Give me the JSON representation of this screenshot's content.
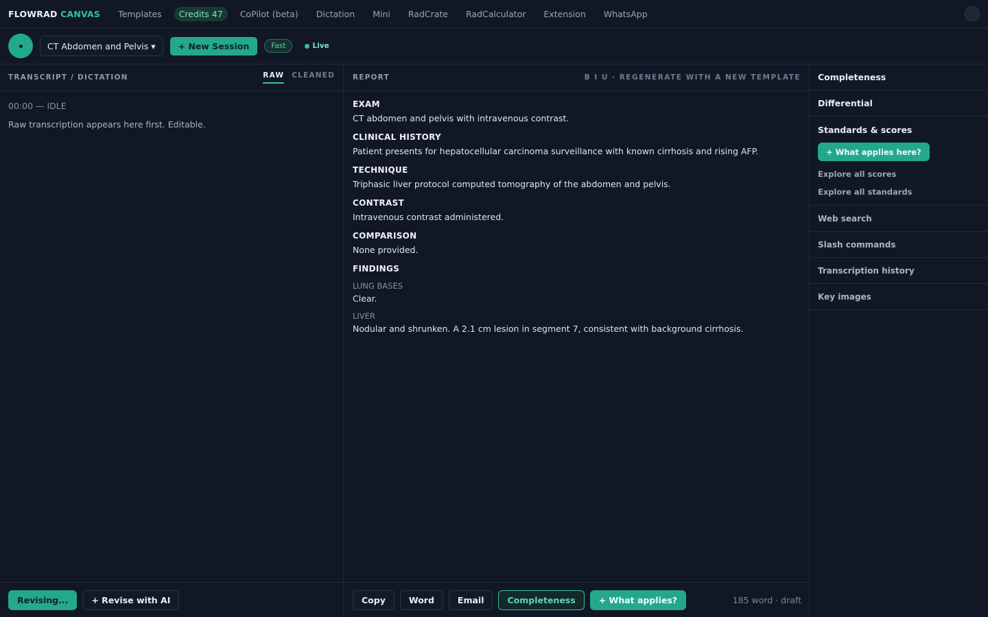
{
  "nav": {
    "brand_main": "FLOWRAD",
    "brand_accent": "CANVAS",
    "templates": "Templates",
    "credits": "Credits 47",
    "copilot": "CoPilot (beta)",
    "dictation": "Dictation",
    "mini": "Mini",
    "radcrate": "RadCrate",
    "radcalculator": "RadCalculator",
    "extension": "Extension",
    "whatsapp": "WhatsApp"
  },
  "toolbar": {
    "template_select": "CT Abdomen and Pelvis ▾",
    "new_session": "+ New Session",
    "mode_chip": "Fast",
    "live_label": "Live"
  },
  "transcript": {
    "title": "TRANSCRIPT / DICTATION",
    "tab_raw": "RAW",
    "tab_cleaned": "CLEANED",
    "timer_status": "00:00 — IDLE",
    "hint": "Raw transcription appears here first. Editable."
  },
  "report": {
    "title": "REPORT",
    "toolbar_text": "B I U · REGENERATE WITH A NEW TEMPLATE",
    "sections": {
      "exam_h": "EXAM",
      "exam_t": "CT abdomen and pelvis with intravenous contrast.",
      "history_h": "CLINICAL HISTORY",
      "history_t": "Patient presents for hepatocellular carcinoma surveillance with known cirrhosis and rising AFP.",
      "technique_h": "TECHNIQUE",
      "technique_t": "Triphasic liver protocol computed tomography of the abdomen and pelvis.",
      "contrast_h": "CONTRAST",
      "contrast_t": "Intravenous contrast administered.",
      "comparison_h": "COMPARISON",
      "comparison_t": "None provided.",
      "findings_h": "FINDINGS",
      "lung_h": "LUNG BASES",
      "lung_t": "Clear.",
      "liver_h": "LIVER",
      "liver_t": "Nodular and shrunken. A 2.1 cm lesion in segment 7, consistent with background cirrhosis."
    }
  },
  "sidebar": {
    "completeness": "Completeness",
    "differential": "Differential",
    "standards_title": "Standards & scores",
    "what_applies_here": "+ What applies here?",
    "explore_scores": "Explore all scores",
    "explore_standards": "Explore all standards",
    "web_search": "Web search",
    "slash_commands": "Slash commands",
    "transcription_history": "Transcription history",
    "key_images": "Key images"
  },
  "bottom_left": {
    "revising": "Revising...",
    "revise_ai": "+ Revise with AI"
  },
  "bottom_mid": {
    "copy": "Copy",
    "word": "Word",
    "email": "Email",
    "completeness": "Completeness",
    "what_applies": "+ What applies?",
    "word_count": "185 word · draft"
  }
}
